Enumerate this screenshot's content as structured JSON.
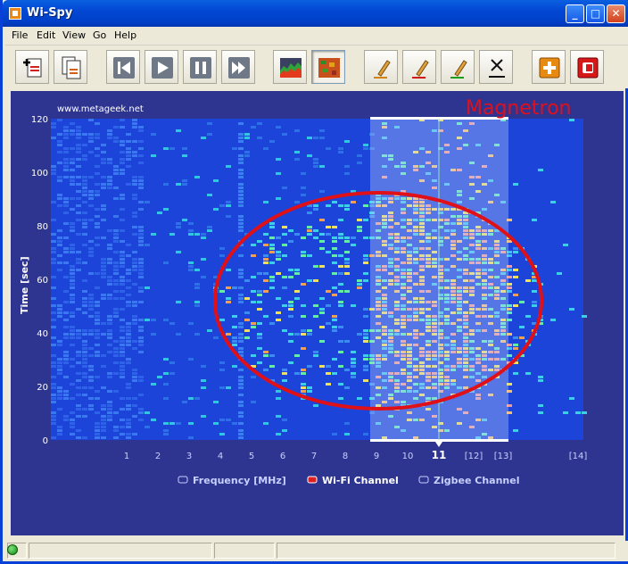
{
  "window": {
    "title": "Wi-Spy",
    "controls": [
      "_",
      "□",
      "✕"
    ]
  },
  "menu": [
    "File",
    "Edit",
    "View",
    "Go",
    "Help"
  ],
  "toolbar": {
    "buttons": [
      "new-icon",
      "copy-icon",
      "skip-back-icon",
      "play-icon",
      "pause-icon",
      "skip-forward-icon",
      "spectrum-chart-icon",
      "density-chart-icon",
      "pencil-orange-icon",
      "pencil-red-icon",
      "pencil-green-icon",
      "clear-markers-icon",
      "plus-icon",
      "record-icon"
    ],
    "pressed": "density-chart-icon"
  },
  "chart": {
    "website": "www.metageek.net",
    "annotation": "Magnetron",
    "annotation_color": "#e0101a",
    "ylabel": "Time [sec]",
    "yticks": [
      "0",
      "20",
      "40",
      "60",
      "80",
      "100",
      "120"
    ],
    "channel_labels": [
      "1",
      "2",
      "3",
      "4",
      "5",
      "6",
      "7",
      "8",
      "9",
      "10",
      "11",
      "[12]",
      "[13]",
      "[14]"
    ],
    "selected_channel": "11",
    "legend": [
      {
        "label": "Frequency [MHz]",
        "color": "#c8d0ff"
      },
      {
        "label": "Wi-Fi Channel",
        "color": "#e02020"
      },
      {
        "label": "Zigbee Channel",
        "color": "#c8d0ff"
      }
    ]
  },
  "chart_data": {
    "type": "heatmap",
    "ylabel": "Time [sec]",
    "ylim": [
      0,
      120
    ],
    "yticks": [
      0,
      20,
      40,
      60,
      80,
      100,
      120
    ],
    "x_categories": [
      "1",
      "2",
      "3",
      "4",
      "5",
      "6",
      "7",
      "8",
      "9",
      "10",
      "11",
      "[12]",
      "[13]",
      "[14]"
    ],
    "highlighted_channel": "11",
    "annotation": "Magnetron",
    "legend": [
      "Frequency [MHz]",
      "Wi-Fi Channel",
      "Zigbee Channel"
    ]
  }
}
